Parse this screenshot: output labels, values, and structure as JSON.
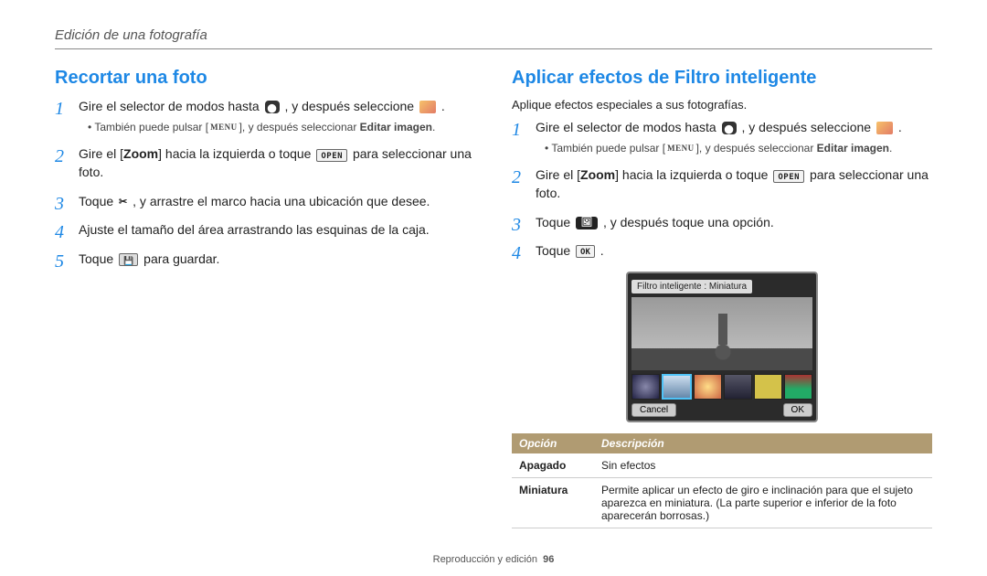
{
  "breadcrumb": "Edición de una fotografía",
  "left": {
    "heading": "Recortar una foto",
    "steps": [
      {
        "pre": "Gire el selector de modos hasta ",
        "icon1_name": "mode-dial-icon",
        "mid1": " , y después seleccione ",
        "icon2_name": "edit-image-icon",
        "post": " .",
        "sub_pre": "También puede pulsar [",
        "sub_btn": "MENU",
        "sub_post": "], y después seleccionar ",
        "sub_bold": "Editar imagen",
        "sub_end": "."
      },
      {
        "pre": "Gire el [",
        "bold": "Zoom",
        "mid1": "] hacia la izquierda o toque ",
        "btn": "OPEN",
        "post": " para seleccionar una foto."
      },
      {
        "pre": "Toque ",
        "icon_name": "crop-icon",
        "post": ", y arrastre el marco hacia una ubicación que desee."
      },
      {
        "text": "Ajuste el tamaño del área arrastrando las esquinas de la caja."
      },
      {
        "pre": "Toque ",
        "icon_name": "save-icon",
        "post": " para guardar."
      }
    ]
  },
  "right": {
    "heading": "Aplicar efectos de Filtro inteligente",
    "intro": "Aplique efectos especiales a sus fotografías.",
    "steps": [
      {
        "pre": "Gire el selector de modos hasta ",
        "icon1_name": "mode-dial-icon",
        "mid1": " , y después seleccione ",
        "icon2_name": "edit-image-icon",
        "post": " .",
        "sub_pre": "También puede pulsar [",
        "sub_btn": "MENU",
        "sub_post": "], y después seleccionar ",
        "sub_bold": "Editar imagen",
        "sub_end": "."
      },
      {
        "pre": "Gire el [",
        "bold": "Zoom",
        "mid1": "] hacia la izquierda o toque ",
        "btn": "OPEN",
        "post": " para seleccionar una foto."
      },
      {
        "pre": "Toque ",
        "icon_name": "smart-filter-icon",
        "post": " , y después toque una opción."
      },
      {
        "pre": "Toque ",
        "btn": "OK",
        "post": " ."
      }
    ],
    "preview": {
      "label": "Filtro inteligente : Miniatura",
      "cancel": "Cancel",
      "ok": "OK"
    },
    "table": {
      "h1": "Opción",
      "h2": "Descripción",
      "rows": [
        {
          "k": "Apagado",
          "v": "Sin efectos"
        },
        {
          "k": "Miniatura",
          "v": "Permite aplicar un efecto de giro e inclinación para que el sujeto aparezca en miniatura. (La parte superior e inferior de la foto aparecerán borrosas.)"
        }
      ]
    }
  },
  "footer": {
    "section": "Reproducción y edición",
    "page": "96"
  }
}
